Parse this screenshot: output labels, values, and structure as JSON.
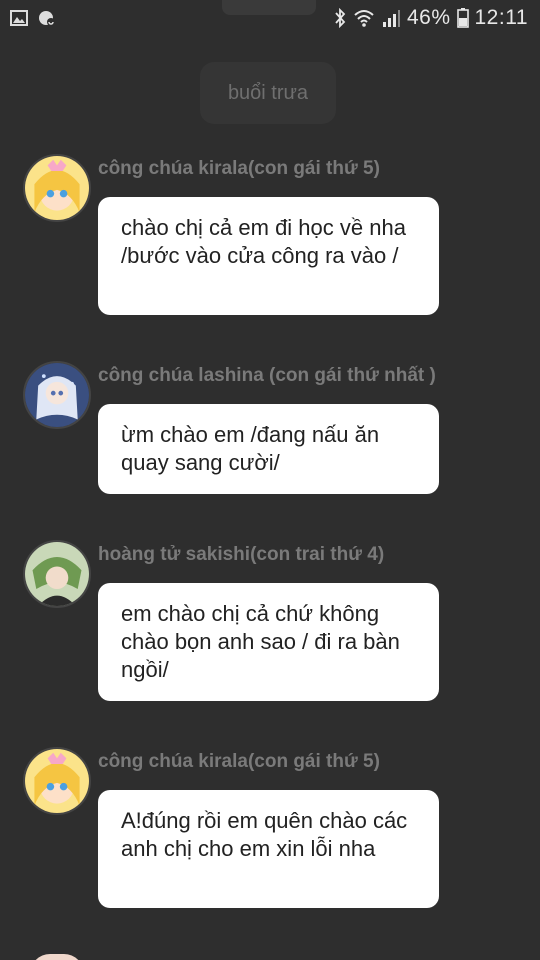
{
  "status_bar": {
    "battery": "46%",
    "time": "12:11",
    "icons": [
      "image-icon",
      "sync-icon",
      "bluetooth-icon",
      "wifi-icon",
      "signal-icon",
      "battery-icon"
    ]
  },
  "time_divider": "buổi trưa",
  "messages": [
    {
      "sender": "công chúa kirala(con gái thứ 5)",
      "text": "chào chị cả em đi học về nha /bước vào cửa công ra vào /"
    },
    {
      "sender": "công chúa lashina (con gái thứ nhất )",
      "text": "ừm chào em /đang nấu ăn quay sang cười/"
    },
    {
      "sender": "hoàng tử sakishi(con trai thứ 4)",
      "text": "em chào chị cả chứ không chào bọn anh sao / đi ra bàn ngồi/"
    },
    {
      "sender": "công chúa kirala(con gái thứ 5)",
      "text": "A!đúng rồi em quên chào các anh chị cho em xin lỗi nha"
    }
  ],
  "colors": {
    "background": "#2e2e2e",
    "bubble": "#ffffff",
    "sender_text": "#7a7a7a",
    "message_text": "#222222"
  }
}
